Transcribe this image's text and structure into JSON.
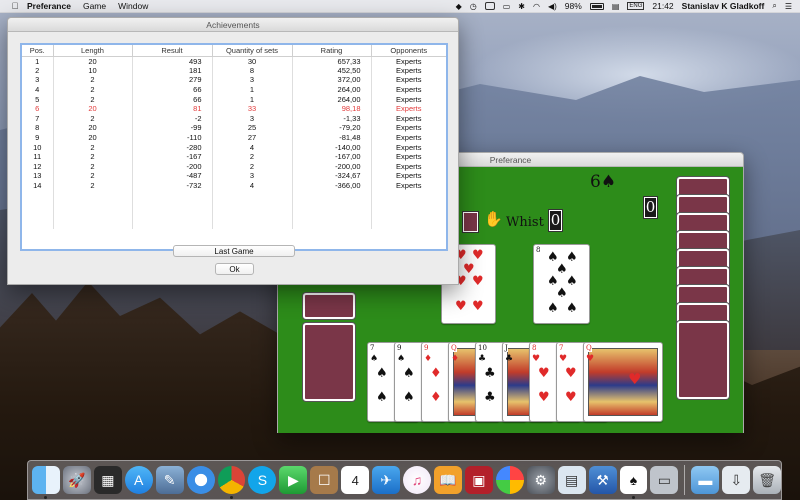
{
  "menubar": {
    "apple": "",
    "items": [
      "Preferance",
      "Game",
      "Window"
    ],
    "battery": "98%",
    "lang": "ENG",
    "time": "21:42",
    "user": "Stanislav K Gladkoff"
  },
  "achievements": {
    "title": "Achievements",
    "columns": [
      "Pos.",
      "Length",
      "Result",
      "Quantity of sets",
      "Rating",
      "Opponents"
    ],
    "rows": [
      [
        "1",
        "20",
        "493",
        "30",
        "657,33",
        "Experts"
      ],
      [
        "2",
        "10",
        "181",
        "8",
        "452,50",
        "Experts"
      ],
      [
        "3",
        "2",
        "279",
        "3",
        "372,00",
        "Experts"
      ],
      [
        "4",
        "2",
        "66",
        "1",
        "264,00",
        "Experts"
      ],
      [
        "5",
        "2",
        "66",
        "1",
        "264,00",
        "Experts"
      ],
      [
        "6",
        "20",
        "81",
        "33",
        "98,18",
        "Experts"
      ],
      [
        "7",
        "2",
        "-2",
        "3",
        "-1,33",
        "Experts"
      ],
      [
        "8",
        "20",
        "-99",
        "25",
        "-79,20",
        "Experts"
      ],
      [
        "9",
        "20",
        "-110",
        "27",
        "-81,48",
        "Experts"
      ],
      [
        "10",
        "2",
        "-280",
        "4",
        "-140,00",
        "Experts"
      ],
      [
        "11",
        "2",
        "-167",
        "2",
        "-167,00",
        "Experts"
      ],
      [
        "12",
        "2",
        "-200",
        "2",
        "-200,00",
        "Experts"
      ],
      [
        "13",
        "2",
        "-487",
        "3",
        "-324,67",
        "Experts"
      ],
      [
        "14",
        "2",
        "-732",
        "4",
        "-366,00",
        "Experts"
      ]
    ],
    "highlight_row_index": 5,
    "highlight_color": "#e23a3a",
    "buttons": {
      "last_game": "Last Game",
      "ok": "Ok"
    }
  },
  "game": {
    "title": "Preferance",
    "felt_color": "#2d8c1a",
    "contract": "6♠",
    "whist_label": "Whist",
    "bid_left": "0",
    "bid_right": "0",
    "center_cards": [
      {
        "rank": "7",
        "suit": "♥",
        "color": "red"
      },
      {
        "rank": "8",
        "suit": "♠",
        "color": "black"
      }
    ],
    "hand": [
      {
        "rank": "7",
        "suit": "♠",
        "color": "black"
      },
      {
        "rank": "9",
        "suit": "♠",
        "color": "black"
      },
      {
        "rank": "9",
        "suit": "♦",
        "color": "red"
      },
      {
        "rank": "Q",
        "suit": "♦",
        "color": "red"
      },
      {
        "rank": "10",
        "suit": "♣",
        "color": "black"
      },
      {
        "rank": "J",
        "suit": "♣",
        "color": "black"
      },
      {
        "rank": "8",
        "suit": "♥",
        "color": "red"
      },
      {
        "rank": "7",
        "suit": "♥",
        "color": "red"
      },
      {
        "rank": "Q",
        "suit": "♥",
        "color": "red"
      }
    ]
  },
  "dock": {
    "apps": [
      "finder-icon",
      "launchpad-icon",
      "mission-control-icon",
      "app-store-icon",
      "preview-icon",
      "safari-icon",
      "chrome-icon",
      "skype-icon",
      "facetime-icon",
      "contacts-icon",
      "calendar-icon",
      "mail-icon",
      "itunes-icon",
      "ibooks-icon",
      "photo-booth-icon",
      "photos-icon",
      "system-preferences-icon",
      "preview-app-icon",
      "xcode-icon",
      "preferance-game-icon",
      "archive-icon",
      "folder-icon",
      "downloads-icon",
      "trash-icon"
    ],
    "calendar_day": "4"
  }
}
